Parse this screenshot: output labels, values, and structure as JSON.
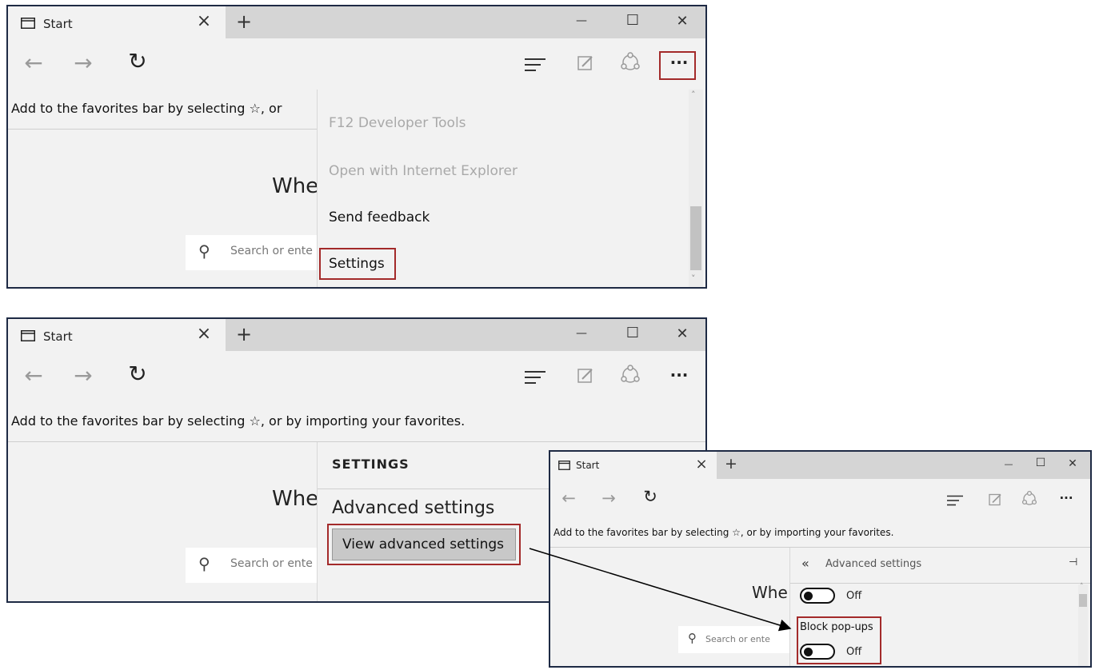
{
  "browser": {
    "tab_title": "Start",
    "close_glyph": "×",
    "newtab_glyph": "+",
    "minimize_glyph": "—",
    "maximize_glyph": "☐",
    "window_close_glyph": "✕",
    "back_glyph": "←",
    "forward_glyph": "→",
    "refresh_glyph": "↻",
    "more_glyph": "···",
    "favbar_text": "Add to the favorites bar by selecting ☆, or by importing your favorites.",
    "favbar_text_cropped": "Add to the favorites bar by selecting ☆, or",
    "where_text": "Whe",
    "search_text": "Search or ente",
    "search_text_short": "Search or ente"
  },
  "more_menu": {
    "items": [
      {
        "label": "F12 Developer Tools",
        "enabled": false
      },
      {
        "label": "Open with Internet Explorer",
        "enabled": false
      },
      {
        "label": "Send feedback",
        "enabled": true
      },
      {
        "label": "Settings",
        "enabled": true
      }
    ]
  },
  "settings_pane": {
    "header": "SETTINGS",
    "section": "Advanced settings",
    "button": "View advanced settings"
  },
  "advanced_pane": {
    "back_glyph": "«",
    "title": "Advanced settings",
    "pin_glyph": "⊣",
    "toggle_1_state": "Off",
    "block_popups_label": "Block pop-ups",
    "toggle_2_state": "Off"
  },
  "colors": {
    "highlight_border": "#a32a2a",
    "window_border": "#1e2a44",
    "chrome_bg": "#f2f2f2",
    "tabstrip_bg": "#d5d5d5"
  }
}
